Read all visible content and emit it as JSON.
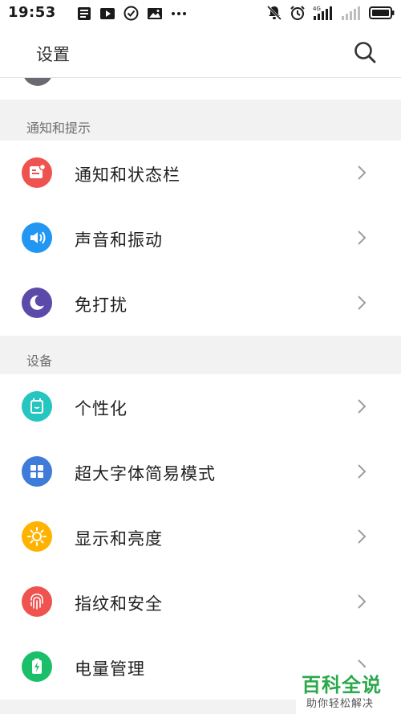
{
  "status_bar": {
    "time": "19:53",
    "left_icons": [
      "image-icon",
      "play-icon",
      "check-circle-icon",
      "picture-icon",
      "more-dots-icon"
    ],
    "right_icons": [
      "mute-icon",
      "alarm-icon",
      "signal-4g-icon",
      "signal-icon",
      "battery-icon"
    ]
  },
  "header": {
    "title": "设置",
    "search_icon": "search-icon"
  },
  "sections": [
    {
      "title": "通知和提示",
      "items": [
        {
          "label": "通知和状态栏",
          "icon": "notification-icon",
          "color": "#ef5350"
        },
        {
          "label": "声音和振动",
          "icon": "speaker-icon",
          "color": "#2196f3"
        },
        {
          "label": "免打扰",
          "icon": "moon-icon",
          "color": "#5c4aa8"
        }
      ]
    },
    {
      "title": "设备",
      "items": [
        {
          "label": "个性化",
          "icon": "personalize-icon",
          "color": "#26c6c0"
        },
        {
          "label": "超大字体简易模式",
          "icon": "grid-icon",
          "color": "#3f7bd8"
        },
        {
          "label": "显示和亮度",
          "icon": "sun-icon",
          "color": "#ffb300"
        },
        {
          "label": "指纹和安全",
          "icon": "fingerprint-icon",
          "color": "#ef5350"
        },
        {
          "label": "电量管理",
          "icon": "battery-charge-icon",
          "color": "#1bbf6a"
        }
      ]
    }
  ],
  "watermark": {
    "title": "百科全说",
    "subtitle": "助你轻松解决"
  }
}
